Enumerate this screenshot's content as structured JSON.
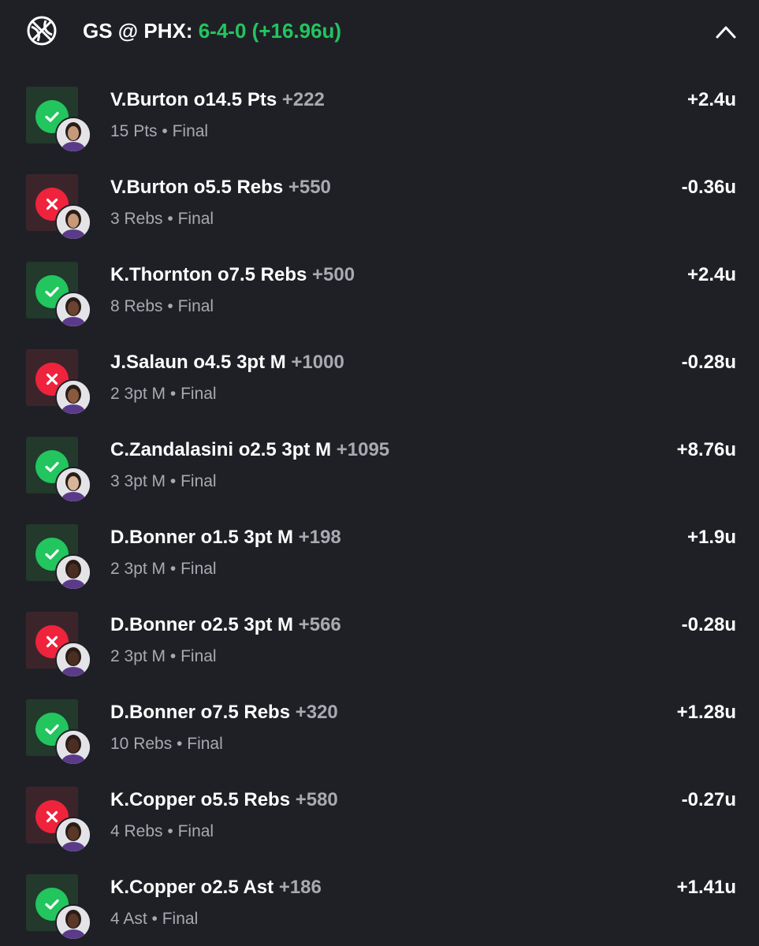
{
  "header": {
    "matchup": "GS @ PHX:",
    "record": "6-4-0 (+16.96u)",
    "sport_icon": "basketball-icon",
    "collapse_icon": "chevron-up-icon"
  },
  "colors": {
    "background": "#1f2026",
    "win": "#22c55e",
    "loss": "#ef233c",
    "muted_text": "#a9a9b0"
  },
  "bets": [
    {
      "result": "win",
      "title": "V.Burton o14.5 Pts",
      "odds": "+222",
      "stat": "15 Pts",
      "status": "Final",
      "units": "+2.4u",
      "skin": "#c49a7a"
    },
    {
      "result": "loss",
      "title": "V.Burton o5.5 Rebs",
      "odds": "+550",
      "stat": "3 Rebs",
      "status": "Final",
      "units": "-0.36u",
      "skin": "#c49a7a"
    },
    {
      "result": "win",
      "title": "K.Thornton o7.5 Rebs",
      "odds": "+500",
      "stat": "8 Rebs",
      "status": "Final",
      "units": "+2.4u",
      "skin": "#6b4330"
    },
    {
      "result": "loss",
      "title": "J.Salaun o4.5 3pt M",
      "odds": "+1000",
      "stat": "2 3pt M",
      "status": "Final",
      "units": "-0.28u",
      "skin": "#8a5a40"
    },
    {
      "result": "win",
      "title": "C.Zandalasini o2.5 3pt M",
      "odds": "+1095",
      "stat": "3 3pt M",
      "status": "Final",
      "units": "+8.76u",
      "skin": "#d8b49a"
    },
    {
      "result": "win",
      "title": "D.Bonner o1.5 3pt M",
      "odds": "+198",
      "stat": "2 3pt M",
      "status": "Final",
      "units": "+1.9u",
      "skin": "#4a2e22"
    },
    {
      "result": "loss",
      "title": "D.Bonner o2.5 3pt M",
      "odds": "+566",
      "stat": "2 3pt M",
      "status": "Final",
      "units": "-0.28u",
      "skin": "#4a2e22"
    },
    {
      "result": "win",
      "title": "D.Bonner o7.5 Rebs",
      "odds": "+320",
      "stat": "10 Rebs",
      "status": "Final",
      "units": "+1.28u",
      "skin": "#4a2e22"
    },
    {
      "result": "loss",
      "title": "K.Copper o5.5 Rebs",
      "odds": "+580",
      "stat": "4 Rebs",
      "status": "Final",
      "units": "-0.27u",
      "skin": "#5a3828"
    },
    {
      "result": "win",
      "title": "K.Copper o2.5 Ast",
      "odds": "+186",
      "stat": "4 Ast",
      "status": "Final",
      "units": "+1.41u",
      "skin": "#5a3828"
    }
  ]
}
